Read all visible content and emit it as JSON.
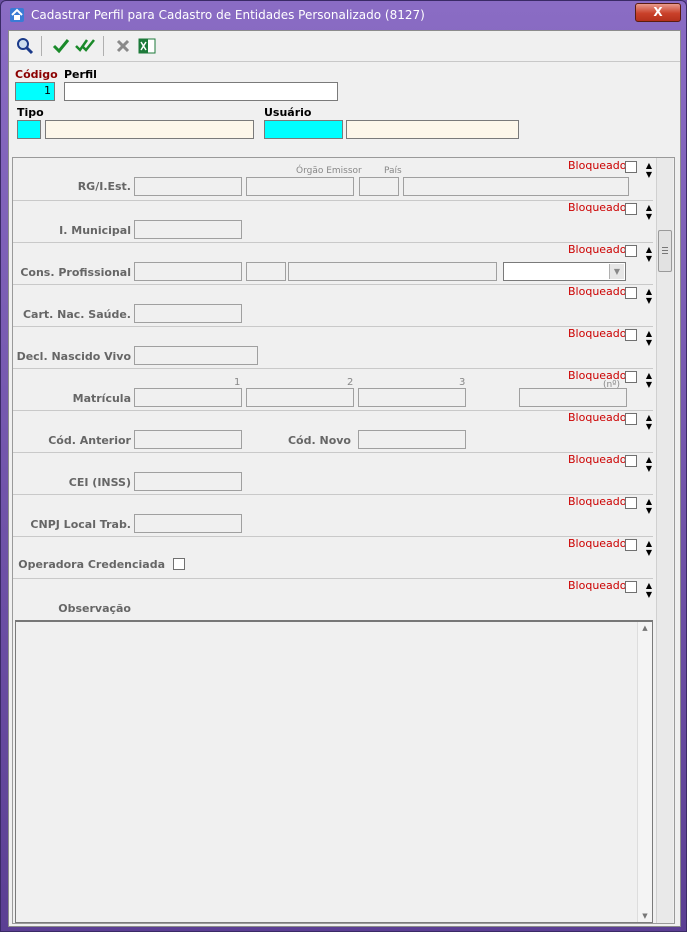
{
  "window": {
    "title": "Cadastrar Perfil para Cadastro de Entidades Personalizado (8127)",
    "close_glyph": "X"
  },
  "toolbar": {
    "icons": [
      "search-icon",
      "confirm-icon",
      "confirm-all-icon",
      "cancel-icon",
      "excel-icon"
    ]
  },
  "header": {
    "codigo_label": "Código",
    "codigo_value": "1",
    "perfil_label": "Perfil",
    "perfil_value": "",
    "tipo_label": "Tipo",
    "usuario_label": "Usuário"
  },
  "sections": {
    "bloqueado": "Bloqueado",
    "rg": {
      "label": "RG/I.Est.",
      "orgao": "Órgão Emissor",
      "pais": "País"
    },
    "im": {
      "label": "I. Municipal"
    },
    "cp": {
      "label": "Cons. Profissional"
    },
    "cns": {
      "label": "Cart. Nac. Saúde."
    },
    "dnv": {
      "label": "Decl. Nascido Vivo"
    },
    "mat": {
      "label": "Matrícula",
      "n1": "1",
      "n2": "2",
      "n3": "3",
      "n4": "(nº)"
    },
    "cod": {
      "anterior": "Cód. Anterior",
      "novo": "Cód. Novo"
    },
    "cei": {
      "label": "CEI (INSS)"
    },
    "cnpj": {
      "label": "CNPJ Local Trab."
    },
    "op": {
      "label": "Operadora Credenciada"
    },
    "obs": {
      "label": "Observação"
    }
  },
  "colors": {
    "accent_red": "#cc0000",
    "required_label": "#8b0000",
    "cyan_field": "#00ffff",
    "beige_field": "#fdf7ea"
  }
}
